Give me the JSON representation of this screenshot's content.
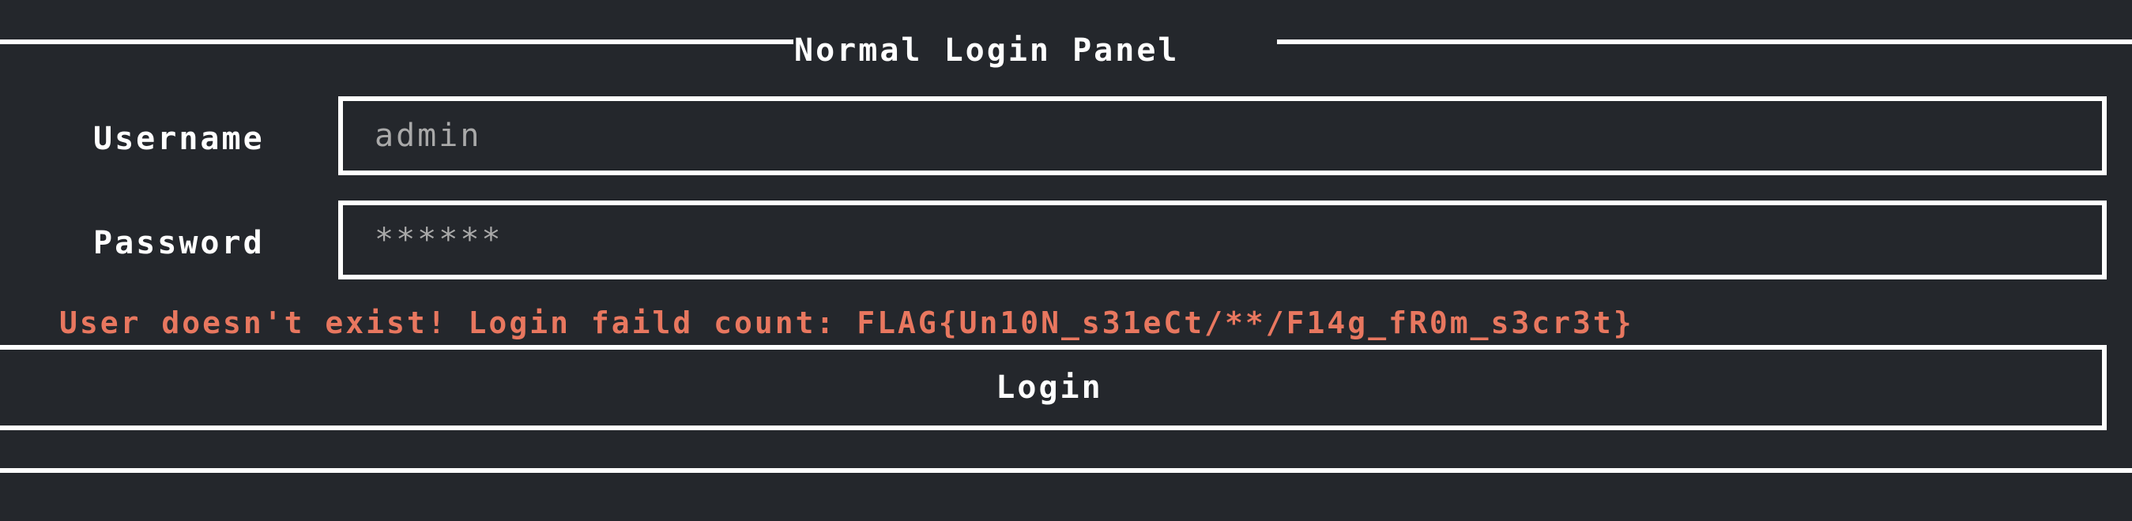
{
  "panel": {
    "title": "Normal Login Panel"
  },
  "form": {
    "username_label": "Username",
    "username_value": "admin",
    "password_label": "Password",
    "password_value": "******"
  },
  "message": {
    "error_text": "User doesn't exist! Login faild count: FLAG{Un10N_s31eCt/**/F14g_fR0m_s3cr3t}",
    "error_color": "#e8775f"
  },
  "actions": {
    "login_label": "Login"
  },
  "colors": {
    "background": "#24272c",
    "foreground": "#ffffff",
    "input_text": "#a9a9a9"
  }
}
